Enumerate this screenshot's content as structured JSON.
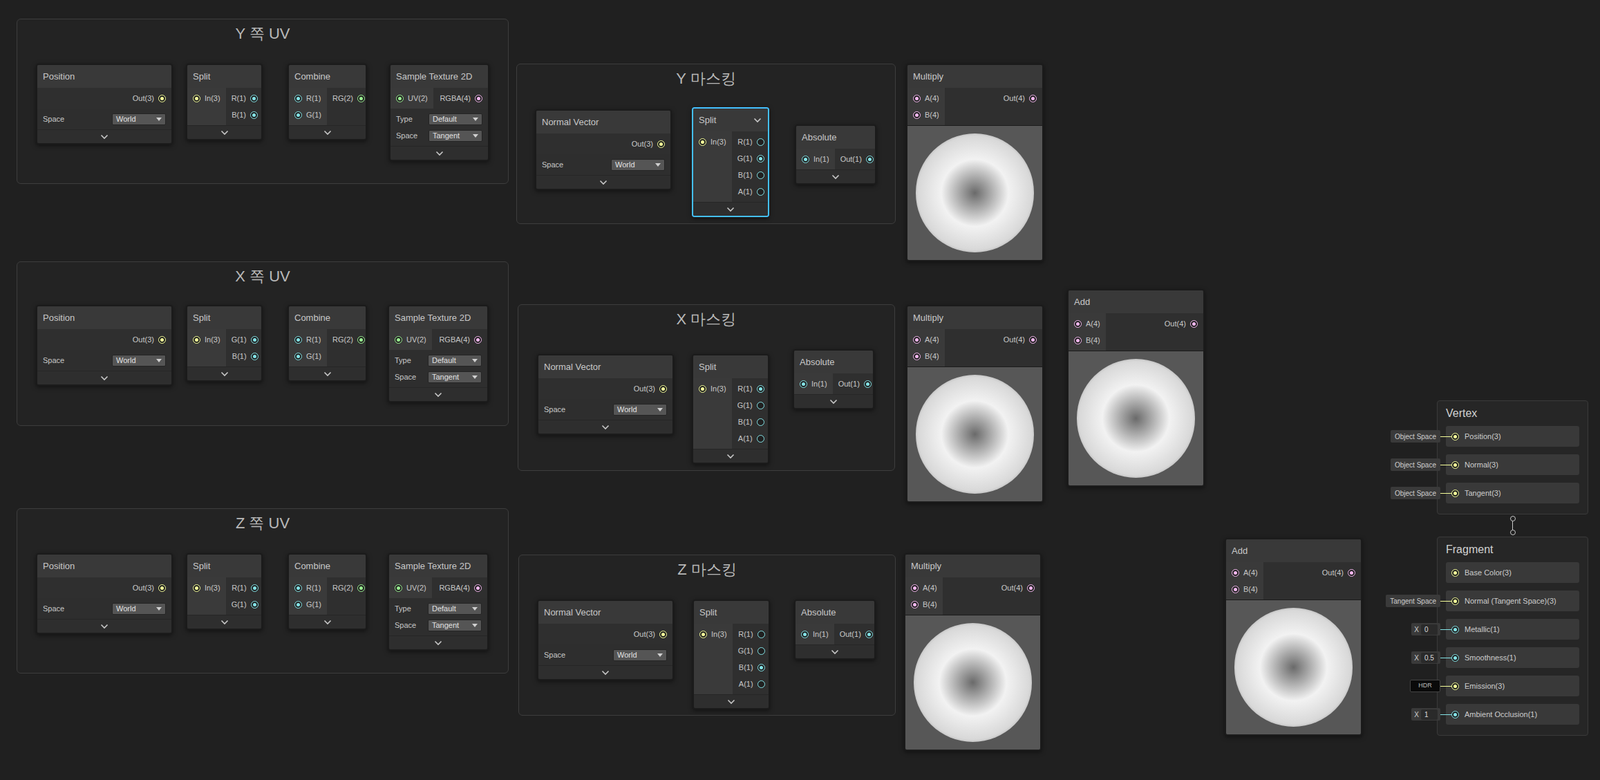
{
  "groups": [
    {
      "title": "Y 쪽 UV"
    },
    {
      "title": "Y 마스킹"
    },
    {
      "title": "X 쪽 UV"
    },
    {
      "title": "X 마스킹"
    },
    {
      "title": "Z 쪽 UV"
    },
    {
      "title": "Z 마스킹"
    }
  ],
  "nodes": [
    {
      "title": "Position",
      "selected": false,
      "preview": false,
      "inputs": [],
      "outputs": [
        {
          "label": "Out(3)",
          "kind": "vec3",
          "connected": true
        }
      ],
      "fields": [
        {
          "label": "Space",
          "value": "World"
        }
      ]
    },
    {
      "title": "Split",
      "selected": false,
      "preview": false,
      "inputs": [
        {
          "label": "In(3)",
          "kind": "vec3",
          "connected": true
        }
      ],
      "outputs": [
        {
          "label": "R(1)",
          "kind": "vec1",
          "connected": true
        },
        {
          "label": "B(1)",
          "kind": "vec1",
          "connected": true
        }
      ],
      "fields": []
    },
    {
      "title": "Combine",
      "selected": false,
      "preview": false,
      "inputs": [
        {
          "label": "R(1)",
          "kind": "vec1",
          "connected": true
        },
        {
          "label": "G(1)",
          "kind": "vec1",
          "connected": true
        }
      ],
      "outputs": [
        {
          "label": "RG(2)",
          "kind": "vec2",
          "connected": true
        }
      ],
      "fields": []
    },
    {
      "title": "Sample Texture 2D",
      "selected": false,
      "preview": false,
      "inputs": [
        {
          "label": "UV(2)",
          "kind": "vec2",
          "connected": true
        }
      ],
      "outputs": [
        {
          "label": "RGBA(4)",
          "kind": "vec4",
          "connected": true
        }
      ],
      "fields": [
        {
          "label": "Type",
          "value": "Default"
        },
        {
          "label": "Space",
          "value": "Tangent"
        }
      ]
    },
    {
      "title": "Normal Vector",
      "selected": false,
      "preview": false,
      "inputs": [],
      "outputs": [
        {
          "label": "Out(3)",
          "kind": "vec3",
          "connected": true
        }
      ],
      "fields": [
        {
          "label": "Space",
          "value": "World"
        }
      ]
    },
    {
      "title": "Split",
      "selected": true,
      "preview": false,
      "inputs": [
        {
          "label": "In(3)",
          "kind": "vec3",
          "connected": true
        }
      ],
      "outputs": [
        {
          "label": "R(1)",
          "kind": "vec1",
          "connected": false
        },
        {
          "label": "G(1)",
          "kind": "vec1",
          "connected": true
        },
        {
          "label": "B(1)",
          "kind": "vec1",
          "connected": false
        },
        {
          "label": "A(1)",
          "kind": "vec1",
          "connected": false
        }
      ],
      "fields": []
    },
    {
      "title": "Absolute",
      "selected": false,
      "preview": false,
      "inputs": [
        {
          "label": "In(1)",
          "kind": "vec1",
          "connected": true
        }
      ],
      "outputs": [
        {
          "label": "Out(1)",
          "kind": "vec1",
          "connected": true
        }
      ],
      "fields": []
    },
    {
      "title": "Multiply",
      "selected": false,
      "preview": true,
      "inputs": [
        {
          "label": "A(4)",
          "kind": "vec4",
          "connected": true
        },
        {
          "label": "B(4)",
          "kind": "vec4",
          "connected": true
        }
      ],
      "outputs": [
        {
          "label": "Out(4)",
          "kind": "vec4",
          "connected": true
        }
      ],
      "fields": []
    },
    {
      "title": "Position",
      "selected": false,
      "preview": false,
      "inputs": [],
      "outputs": [
        {
          "label": "Out(3)",
          "kind": "vec3",
          "connected": true
        }
      ],
      "fields": [
        {
          "label": "Space",
          "value": "World"
        }
      ]
    },
    {
      "title": "Split",
      "selected": false,
      "preview": false,
      "inputs": [
        {
          "label": "In(3)",
          "kind": "vec3",
          "connected": true
        }
      ],
      "outputs": [
        {
          "label": "G(1)",
          "kind": "vec1",
          "connected": true
        },
        {
          "label": "B(1)",
          "kind": "vec1",
          "connected": true
        }
      ],
      "fields": []
    },
    {
      "title": "Combine",
      "selected": false,
      "preview": false,
      "inputs": [
        {
          "label": "R(1)",
          "kind": "vec1",
          "connected": true
        },
        {
          "label": "G(1)",
          "kind": "vec1",
          "connected": true
        }
      ],
      "outputs": [
        {
          "label": "RG(2)",
          "kind": "vec2",
          "connected": true
        }
      ],
      "fields": []
    },
    {
      "title": "Sample Texture 2D",
      "selected": false,
      "preview": false,
      "inputs": [
        {
          "label": "UV(2)",
          "kind": "vec2",
          "connected": true
        }
      ],
      "outputs": [
        {
          "label": "RGBA(4)",
          "kind": "vec4",
          "connected": true
        }
      ],
      "fields": [
        {
          "label": "Type",
          "value": "Default"
        },
        {
          "label": "Space",
          "value": "Tangent"
        }
      ]
    },
    {
      "title": "Normal Vector",
      "selected": false,
      "preview": false,
      "inputs": [],
      "outputs": [
        {
          "label": "Out(3)",
          "kind": "vec3",
          "connected": true
        }
      ],
      "fields": [
        {
          "label": "Space",
          "value": "World"
        }
      ]
    },
    {
      "title": "Split",
      "selected": false,
      "preview": false,
      "inputs": [
        {
          "label": "In(3)",
          "kind": "vec3",
          "connected": true
        }
      ],
      "outputs": [
        {
          "label": "R(1)",
          "kind": "vec1",
          "connected": true
        },
        {
          "label": "G(1)",
          "kind": "vec1",
          "connected": false
        },
        {
          "label": "B(1)",
          "kind": "vec1",
          "connected": false
        },
        {
          "label": "A(1)",
          "kind": "vec1",
          "connected": false
        }
      ],
      "fields": []
    },
    {
      "title": "Absolute",
      "selected": false,
      "preview": false,
      "inputs": [
        {
          "label": "In(1)",
          "kind": "vec1",
          "connected": true
        }
      ],
      "outputs": [
        {
          "label": "Out(1)",
          "kind": "vec1",
          "connected": true
        }
      ],
      "fields": []
    },
    {
      "title": "Multiply",
      "selected": false,
      "preview": true,
      "inputs": [
        {
          "label": "A(4)",
          "kind": "vec4",
          "connected": true
        },
        {
          "label": "B(4)",
          "kind": "vec4",
          "connected": true
        }
      ],
      "outputs": [
        {
          "label": "Out(4)",
          "kind": "vec4",
          "connected": true
        }
      ],
      "fields": []
    },
    {
      "title": "Add",
      "selected": false,
      "preview": true,
      "inputs": [
        {
          "label": "A(4)",
          "kind": "vec4",
          "connected": true
        },
        {
          "label": "B(4)",
          "kind": "vec4",
          "connected": true
        }
      ],
      "outputs": [
        {
          "label": "Out(4)",
          "kind": "vec4",
          "connected": true
        }
      ],
      "fields": []
    },
    {
      "title": "Position",
      "selected": false,
      "preview": false,
      "inputs": [],
      "outputs": [
        {
          "label": "Out(3)",
          "kind": "vec3",
          "connected": true
        }
      ],
      "fields": [
        {
          "label": "Space",
          "value": "World"
        }
      ]
    },
    {
      "title": "Split",
      "selected": false,
      "preview": false,
      "inputs": [
        {
          "label": "In(3)",
          "kind": "vec3",
          "connected": true
        }
      ],
      "outputs": [
        {
          "label": "R(1)",
          "kind": "vec1",
          "connected": true
        },
        {
          "label": "G(1)",
          "kind": "vec1",
          "connected": true
        }
      ],
      "fields": []
    },
    {
      "title": "Combine",
      "selected": false,
      "preview": false,
      "inputs": [
        {
          "label": "R(1)",
          "kind": "vec1",
          "connected": true
        },
        {
          "label": "G(1)",
          "kind": "vec1",
          "connected": true
        }
      ],
      "outputs": [
        {
          "label": "RG(2)",
          "kind": "vec2",
          "connected": true
        }
      ],
      "fields": []
    },
    {
      "title": "Sample Texture 2D",
      "selected": false,
      "preview": false,
      "inputs": [
        {
          "label": "UV(2)",
          "kind": "vec2",
          "connected": true
        }
      ],
      "outputs": [
        {
          "label": "RGBA(4)",
          "kind": "vec4",
          "connected": true
        }
      ],
      "fields": [
        {
          "label": "Type",
          "value": "Default"
        },
        {
          "label": "Space",
          "value": "Tangent"
        }
      ]
    },
    {
      "title": "Normal Vector",
      "selected": false,
      "preview": false,
      "inputs": [],
      "outputs": [
        {
          "label": "Out(3)",
          "kind": "vec3",
          "connected": true
        }
      ],
      "fields": [
        {
          "label": "Space",
          "value": "World"
        }
      ]
    },
    {
      "title": "Split",
      "selected": false,
      "preview": false,
      "inputs": [
        {
          "label": "In(3)",
          "kind": "vec3",
          "connected": true
        }
      ],
      "outputs": [
        {
          "label": "R(1)",
          "kind": "vec1",
          "connected": false
        },
        {
          "label": "G(1)",
          "kind": "vec1",
          "connected": false
        },
        {
          "label": "B(1)",
          "kind": "vec1",
          "connected": true
        },
        {
          "label": "A(1)",
          "kind": "vec1",
          "connected": false
        }
      ],
      "fields": []
    },
    {
      "title": "Absolute",
      "selected": false,
      "preview": false,
      "inputs": [
        {
          "label": "In(1)",
          "kind": "vec1",
          "connected": true
        }
      ],
      "outputs": [
        {
          "label": "Out(1)",
          "kind": "vec1",
          "connected": true
        }
      ],
      "fields": []
    },
    {
      "title": "Multiply",
      "selected": false,
      "preview": true,
      "inputs": [
        {
          "label": "A(4)",
          "kind": "vec4",
          "connected": true
        },
        {
          "label": "B(4)",
          "kind": "vec4",
          "connected": true
        }
      ],
      "outputs": [
        {
          "label": "Out(4)",
          "kind": "vec4",
          "connected": true
        }
      ],
      "fields": []
    },
    {
      "title": "Add",
      "selected": false,
      "preview": true,
      "inputs": [
        {
          "label": "A(4)",
          "kind": "vec4",
          "connected": true
        },
        {
          "label": "B(4)",
          "kind": "vec4",
          "connected": true
        }
      ],
      "outputs": [
        {
          "label": "Out(4)",
          "kind": "vec4",
          "connected": true
        }
      ],
      "fields": []
    }
  ],
  "stack": {
    "vertex": {
      "title": "Vertex",
      "slots": [
        {
          "label": "Position(3)",
          "kind": "vec3",
          "input": {
            "kind": "space",
            "text": "Object Space"
          }
        },
        {
          "label": "Normal(3)",
          "kind": "vec3",
          "input": {
            "kind": "space",
            "text": "Object Space"
          }
        },
        {
          "label": "Tangent(3)",
          "kind": "vec3",
          "input": {
            "kind": "space",
            "text": "Object Space"
          }
        }
      ]
    },
    "fragment": {
      "title": "Fragment",
      "slots": [
        {
          "label": "Base Color(3)",
          "kind": "vec3",
          "input": {
            "kind": "none"
          }
        },
        {
          "label": "Normal (Tangent Space)(3)",
          "kind": "vec3",
          "input": {
            "kind": "space",
            "text": "Tangent Space"
          }
        },
        {
          "label": "Metallic(1)",
          "kind": "vec1",
          "input": {
            "kind": "number",
            "axis": "X",
            "value": "0"
          }
        },
        {
          "label": "Smoothness(1)",
          "kind": "vec1",
          "input": {
            "kind": "number",
            "axis": "X",
            "value": "0.5"
          }
        },
        {
          "label": "Emission(3)",
          "kind": "vec3",
          "input": {
            "kind": "color",
            "text": "HDR"
          }
        },
        {
          "label": "Ambient Occlusion(1)",
          "kind": "vec1",
          "input": {
            "kind": "number",
            "axis": "X",
            "value": "1"
          }
        }
      ]
    }
  }
}
